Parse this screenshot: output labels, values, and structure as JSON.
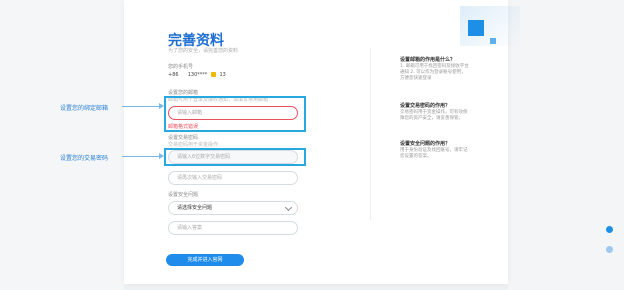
{
  "page": {
    "title": "完善资料",
    "subtitle": "为了您的安全，请完善您的资料"
  },
  "phone": {
    "label": "您的手机号",
    "country_code": "+86",
    "number": "130****",
    "suffix": "13"
  },
  "email": {
    "label": "设置您的邮箱",
    "hint": "邮箱可用于登录及接收通知，请填写常用邮箱",
    "placeholder": "请输入邮箱",
    "error": "邮箱格式错误"
  },
  "trade_password": {
    "label": "设置交易密码",
    "hint": "交易密码用于资金操作",
    "placeholder": "请输入6位数字交易密码",
    "confirm_placeholder": "请再次输入交易密码"
  },
  "security_question": {
    "label": "设置安全问题",
    "selected": "请选择安全问题",
    "answer_placeholder": "请输入答案"
  },
  "submit_label": "完成并进入官网",
  "annotations": {
    "email": "设置您的绑定邮箱",
    "trade": "设置您的交易密码"
  },
  "help": [
    {
      "title": "设置邮箱的作用是什么？",
      "text": "1. 邮箱可用于找回密码及接收平台通知 2. 可以作为登录账号使用，方便您快速登录"
    },
    {
      "title": "设置交易密码的作用？",
      "text": "交易密码用于资金操作，可有效保障您的资产安全，请妥善保管。"
    },
    {
      "title": "设置安全问题的作用？",
      "text": "用于身份验证及找回账号，请牢记您设置的答案。"
    }
  ],
  "colors": {
    "accent": "#1f8ceb",
    "error": "#e8515b",
    "highlight": "#29a8df"
  }
}
